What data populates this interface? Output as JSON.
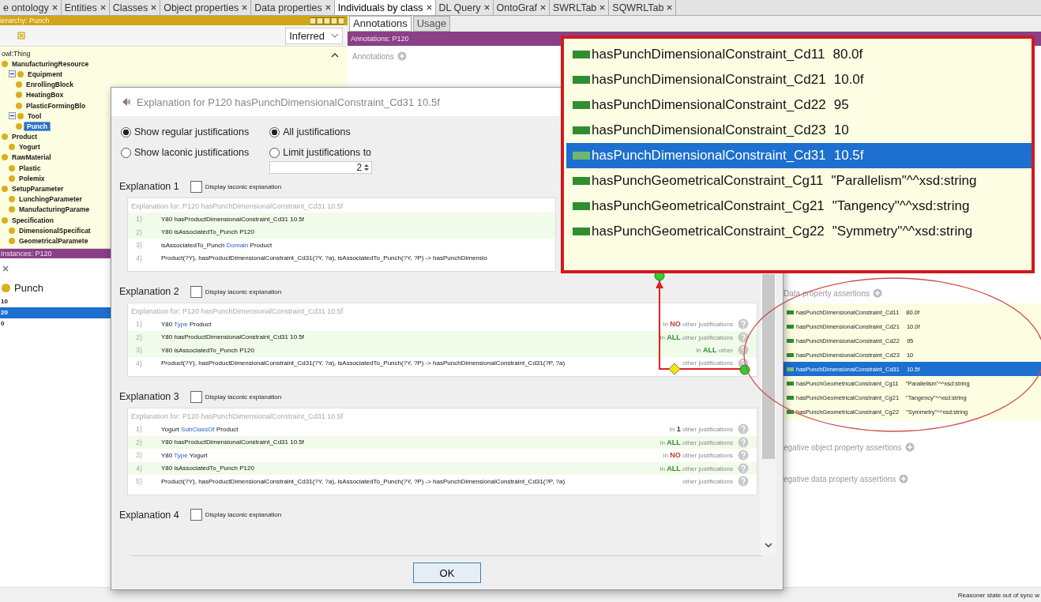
{
  "tabs": [
    {
      "label": "e ontology",
      "selected": false
    },
    {
      "label": "Entities",
      "selected": false
    },
    {
      "label": "Classes",
      "selected": false
    },
    {
      "label": "Object properties",
      "selected": false
    },
    {
      "label": "Data properties",
      "selected": false
    },
    {
      "label": "Individuals by class",
      "selected": true
    },
    {
      "label": "DL Query",
      "selected": false
    },
    {
      "label": "OntoGraf",
      "selected": false
    },
    {
      "label": "SWRLTab",
      "selected": false
    },
    {
      "label": "SQWRLTab",
      "selected": false
    }
  ],
  "class_hierarchy": {
    "title": "ierarchy: Punch",
    "mode": "Inferred",
    "tree": [
      {
        "label": "owl:Thing",
        "root": true,
        "selected": false,
        "children": [
          {
            "label": "ManufacturingResource",
            "selected": false,
            "children": [
              {
                "label": "Equipment",
                "expanded": true,
                "selected": false,
                "children": [
                  {
                    "label": "EnrollingBlock",
                    "selected": false
                  },
                  {
                    "label": "HeatingBox",
                    "selected": false
                  },
                  {
                    "label": "PlasticFormingBlo",
                    "selected": false
                  }
                ]
              },
              {
                "label": "Tool",
                "expanded": true,
                "selected": false,
                "children": [
                  {
                    "label": "Punch",
                    "selected": true
                  }
                ]
              }
            ]
          },
          {
            "label": "Product",
            "selected": false,
            "children": [
              {
                "label": "Yogurt",
                "selected": false
              }
            ]
          },
          {
            "label": "RawMaterial",
            "selected": false,
            "children": [
              {
                "label": "Plastic",
                "selected": false
              },
              {
                "label": "Polemix",
                "selected": false
              }
            ]
          },
          {
            "label": "SetupParameter",
            "selected": false,
            "children": [
              {
                "label": "LunchingParameter",
                "selected": false
              },
              {
                "label": "ManufacturingParame",
                "selected": false
              }
            ]
          },
          {
            "label": "Specification",
            "selected": false,
            "children": [
              {
                "label": "DimensionalSpecificat",
                "selected": false
              },
              {
                "label": "GeometricalParamete",
                "selected": false
              }
            ]
          }
        ]
      }
    ]
  },
  "instances": {
    "title": "Instances: P120",
    "class": "Punch",
    "items": [
      {
        "label": "10",
        "selected": false
      },
      {
        "label": "20",
        "selected": true
      },
      {
        "label": "0",
        "selected": false
      }
    ]
  },
  "annotation_tabs": [
    {
      "label": "Annotations",
      "selected": true
    },
    {
      "label": "Usage",
      "selected": false
    }
  ],
  "annotations": {
    "title": "Annotations: P120",
    "label": "Annotations"
  },
  "callout": {
    "items": [
      {
        "name": "hasPunchDimensionalConstraint_Cd11",
        "value": "80.0f",
        "selected": false
      },
      {
        "name": "hasPunchDimensionalConstraint_Cd21",
        "value": "10.0f",
        "selected": false
      },
      {
        "name": "hasPunchDimensionalConstraint_Cd22",
        "value": "95",
        "selected": false
      },
      {
        "name": "hasPunchDimensionalConstraint_Cd23",
        "value": "10",
        "selected": false
      },
      {
        "name": "hasPunchDimensionalConstraint_Cd31",
        "value": "10.5f",
        "selected": true
      },
      {
        "name": "hasPunchGeometricalConstraint_Cg11",
        "value": "\"Parallelism\"^^xsd:string",
        "selected": false
      },
      {
        "name": "hasPunchGeometricalConstraint_Cg21",
        "value": "\"Tangency\"^^xsd:string",
        "selected": false
      },
      {
        "name": "hasPunchGeometricalConstraint_Cg22",
        "value": "\"Symmetry\"^^xsd:string",
        "selected": false
      }
    ]
  },
  "property_assertions": {
    "data_title": "Data property assertions",
    "data_items": [
      {
        "name": "hasPunchDimensionalConstraint_Cd11",
        "value": "80.0f",
        "selected": false
      },
      {
        "name": "hasPunchDimensionalConstraint_Cd21",
        "value": "10.0f",
        "selected": false
      },
      {
        "name": "hasPunchDimensionalConstraint_Cd22",
        "value": "95",
        "selected": false
      },
      {
        "name": "hasPunchDimensionalConstraint_Cd23",
        "value": "10",
        "selected": false
      },
      {
        "name": "hasPunchDimensionalConstraint_Cd31",
        "value": "10.5f",
        "selected": true
      },
      {
        "name": "hasPunchGeometricalConstraint_Cg11",
        "value": "\"Parallelism\"^^xsd:string",
        "selected": false
      },
      {
        "name": "hasPunchGeometricalConstraint_Cg21",
        "value": "\"Tangency\"^^xsd:string",
        "selected": false
      },
      {
        "name": "hasPunchGeometricalConstraint_Cg22",
        "value": "\"Symmetry\"^^xsd:string",
        "selected": false
      }
    ],
    "negative_object_title": "egative object property assertions",
    "negative_data_title": "egative data property assertions"
  },
  "dialog": {
    "title": "Explanation for P120 hasPunchDimensionalConstraint_Cd31 10.5f",
    "display_mode": [
      {
        "label": "Show regular justifications",
        "selected": true
      },
      {
        "label": "Show laconic justifications",
        "selected": false
      }
    ],
    "limit_mode": [
      {
        "label": "All justifications",
        "selected": true
      },
      {
        "label": "Limit justifications to",
        "selected": false
      }
    ],
    "limit_value": "2",
    "explanations": [
      {
        "title": "Explanation 1",
        "laconic_label": "Display laconic explanation",
        "laconic": false,
        "header": "Explanation for: P120 hasPunchDimensionalConstraint_Cd31 10.5f",
        "lines": [
          {
            "number": "1)",
            "highlighted": true,
            "help": false,
            "parts": [
              {
                "kind": "plain",
                "text": "Y80 hasProductDimensionalConstraint_Cd31 10.5f"
              }
            ]
          },
          {
            "number": "2)",
            "highlighted": true,
            "help": false,
            "parts": [
              {
                "kind": "plain",
                "text": "Y80 isAssociatedTo_Punch P120"
              }
            ]
          },
          {
            "number": "3)",
            "highlighted": false,
            "help": false,
            "parts": [
              {
                "kind": "plain",
                "text": "isAssociatedTo_Punch"
              },
              {
                "kind": "keyword",
                "text": "Domain"
              },
              {
                "kind": "plain",
                "text": "Product"
              }
            ]
          },
          {
            "number": "4)",
            "highlighted": false,
            "help": false,
            "parts": [
              {
                "kind": "plain",
                "text": "Product(?Y), hasProductDimensionalConstraint_Cd31(?Y, ?a), isAssociatedTo_Punch(?Y, ?P) -> hasPunchDimensio"
              }
            ]
          }
        ]
      },
      {
        "title": "Explanation 2",
        "laconic_label": "Display laconic explanation",
        "laconic": false,
        "header": "Explanation for: P120 hasPunchDimensionalConstraint_Cd31 10.5f",
        "lines": [
          {
            "number": "1)",
            "highlighted": false,
            "help": true,
            "parts": [
              {
                "kind": "plain",
                "text": "Y80"
              },
              {
                "kind": "keyword",
                "text": "Type"
              },
              {
                "kind": "plain",
                "text": "Product"
              }
            ],
            "usage": {
              "prefix": "In",
              "count": "NO",
              "color": "#c0392b",
              "suffix": "other justifications"
            }
          },
          {
            "number": "2)",
            "highlighted": true,
            "help": true,
            "parts": [
              {
                "kind": "plain",
                "text": "Y80 hasProductDimensionalConstraint_Cd31 10.5f"
              }
            ],
            "usage": {
              "prefix": "In",
              "count": "ALL",
              "color": "#2e8b2e",
              "suffix": "other justifications"
            }
          },
          {
            "number": "3)",
            "highlighted": true,
            "help": true,
            "parts": [
              {
                "kind": "plain",
                "text": "Y80 isAssociatedTo_Punch P120"
              }
            ],
            "usage": {
              "prefix": "In",
              "count": "ALL",
              "color": "#2e8b2e",
              "suffix": "other"
            }
          },
          {
            "number": "4)",
            "highlighted": false,
            "help": true,
            "parts": [
              {
                "kind": "plain",
                "text": "Product(?Y), hasProductDimensionalConstraint_Cd31(?Y, ?a), isAssociatedTo_Punch(?Y, ?P) -> hasPunchDimensionalConstraint_Cd31(?P, ?a)"
              }
            ],
            "usage": {
              "suffix": "other justifications"
            }
          }
        ]
      },
      {
        "title": "Explanation 3",
        "laconic_label": "Display laconic explanation",
        "laconic": false,
        "header": "Explanation for: P120 hasPunchDimensionalConstraint_Cd31 10.5f",
        "lines": [
          {
            "number": "1)",
            "highlighted": false,
            "help": true,
            "parts": [
              {
                "kind": "plain",
                "text": "Yogurt"
              },
              {
                "kind": "keyword",
                "text": "SubClassOf"
              },
              {
                "kind": "plain",
                "text": "Product"
              }
            ],
            "usage": {
              "prefix": "In",
              "count": "1",
              "color": "#333333",
              "suffix": "other justifications"
            }
          },
          {
            "number": "2)",
            "highlighted": true,
            "help": true,
            "parts": [
              {
                "kind": "plain",
                "text": "Y80 hasProductDimensionalConstraint_Cd31 10.5f"
              }
            ],
            "usage": {
              "prefix": "In",
              "count": "ALL",
              "color": "#2e8b2e",
              "suffix": "other justifications"
            }
          },
          {
            "number": "3)",
            "highlighted": false,
            "help": true,
            "parts": [
              {
                "kind": "plain",
                "text": "Y80"
              },
              {
                "kind": "keyword",
                "text": "Type"
              },
              {
                "kind": "plain",
                "text": "Yogurt"
              }
            ],
            "usage": {
              "prefix": "In",
              "count": "NO",
              "color": "#c0392b",
              "suffix": "other justifications"
            }
          },
          {
            "number": "4)",
            "highlighted": true,
            "help": true,
            "parts": [
              {
                "kind": "plain",
                "text": "Y80 isAssociatedTo_Punch P120"
              }
            ],
            "usage": {
              "prefix": "In",
              "count": "ALL",
              "color": "#2e8b2e",
              "suffix": "other justifications"
            }
          },
          {
            "number": "5)",
            "highlighted": false,
            "help": true,
            "parts": [
              {
                "kind": "plain",
                "text": "Product(?Y), hasProductDimensionalConstraint_Cd31(?Y, ?a), isAssociatedTo_Punch(?Y, ?P) -> hasPunchDimensionalConstraint_Cd31(?P, ?a)"
              }
            ],
            "usage": {
              "suffix": "other justifications"
            }
          }
        ]
      },
      {
        "title": "Explanation 4",
        "laconic_label": "Display laconic explanation",
        "laconic": false
      }
    ],
    "ok": "OK"
  },
  "status": "Reasoner state out of sync w"
}
